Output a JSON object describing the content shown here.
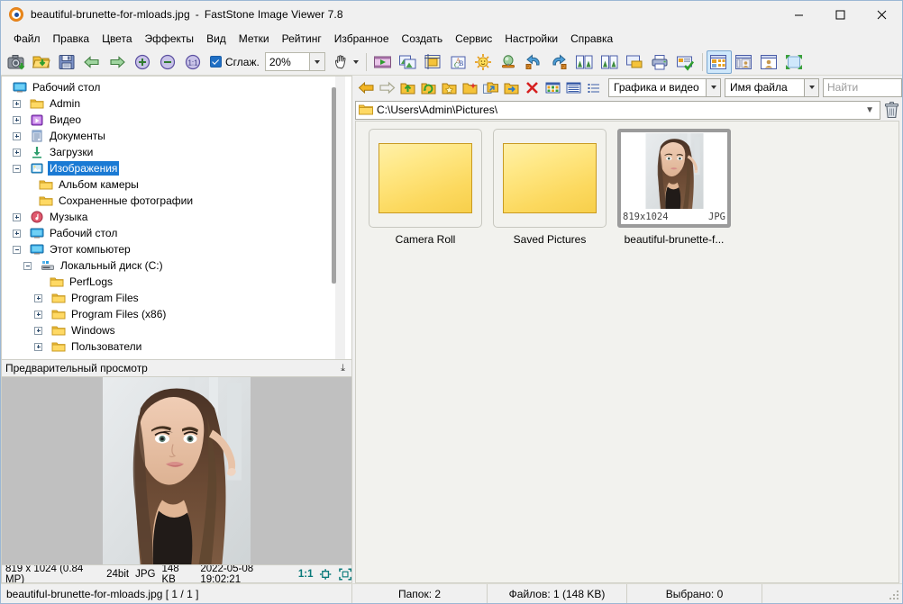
{
  "window": {
    "icon": "faststone-eye-icon",
    "file_name": "beautiful-brunette-for-mloads.jpg",
    "separator": "-",
    "app_title": "FastStone Image Viewer 7.8",
    "minimize_label": "—",
    "maximize_label": "□",
    "close_label": "✕"
  },
  "menu": {
    "items": [
      {
        "label": "Файл",
        "name": "menu-file"
      },
      {
        "label": "Правка",
        "name": "menu-edit"
      },
      {
        "label": "Цвета",
        "name": "menu-colors"
      },
      {
        "label": "Эффекты",
        "name": "menu-effects"
      },
      {
        "label": "Вид",
        "name": "menu-view"
      },
      {
        "label": "Метки",
        "name": "menu-tags"
      },
      {
        "label": "Рейтинг",
        "name": "menu-rating"
      },
      {
        "label": "Избранное",
        "name": "menu-favorites"
      },
      {
        "label": "Создать",
        "name": "menu-create"
      },
      {
        "label": "Сервис",
        "name": "menu-tools"
      },
      {
        "label": "Настройки",
        "name": "menu-settings"
      },
      {
        "label": "Справка",
        "name": "menu-help"
      }
    ]
  },
  "toolbar": {
    "smoothing_label": "Сглаж.",
    "smoothing_checked": true,
    "zoom_value": "20%",
    "icons": [
      "acquire-camera-icon",
      "open-folder-icon",
      "save-as-icon",
      "previous-image-icon",
      "next-image-icon",
      "zoom-in-icon",
      "zoom-out-icon",
      "actual-size-icon"
    ],
    "icons2": [
      "slideshow-icon",
      "compare-images-icon",
      "crop-icon",
      "adjust-colors-icon",
      "adjust-lighting-icon",
      "red-eye-icon",
      "rotate-left-icon",
      "rotate-right-icon",
      "resize-icon",
      "resize-canvas-icon",
      "screen-capture-icon",
      "print-icon",
      "email-icon"
    ],
    "view_modes": [
      "thumbnail-view-icon",
      "filmstrip-view-icon",
      "preview-view-icon",
      "fullscreen-icon"
    ],
    "active_view_mode_index": 0,
    "hand_tool": "hand-tool-icon",
    "accent_selected": "#cfe8fb"
  },
  "tree": {
    "scroll_position": "top",
    "nodes": [
      {
        "label": "Рабочий стол",
        "icon": "desktop-icon",
        "indent": 0,
        "expander": "none",
        "selected": false
      },
      {
        "label": "Admin",
        "icon": "folder-icon",
        "indent": 1,
        "expander": "plus",
        "selected": false
      },
      {
        "label": "Видео",
        "icon": "videos-icon",
        "indent": 1,
        "expander": "plus",
        "selected": false
      },
      {
        "label": "Документы",
        "icon": "documents-icon",
        "indent": 1,
        "expander": "plus",
        "selected": false
      },
      {
        "label": "Загрузки",
        "icon": "downloads-icon",
        "indent": 1,
        "expander": "plus",
        "selected": false
      },
      {
        "label": "Изображения",
        "icon": "pictures-icon",
        "indent": 1,
        "expander": "minus",
        "selected": true
      },
      {
        "label": "Альбом камеры",
        "icon": "folder-icon",
        "indent": 2,
        "expander": "none",
        "selected": false
      },
      {
        "label": "Сохраненные фотографии",
        "icon": "folder-icon",
        "indent": 2,
        "expander": "none",
        "selected": false
      },
      {
        "label": "Музыка",
        "icon": "music-icon",
        "indent": 1,
        "expander": "plus",
        "selected": false
      },
      {
        "label": "Рабочий стол",
        "icon": "desktop-icon",
        "indent": 1,
        "expander": "plus",
        "selected": false
      },
      {
        "label": "Этот компьютер",
        "icon": "computer-icon",
        "indent": 1,
        "expander": "minus",
        "selected": false
      },
      {
        "label": "Локальный диск (C:)",
        "icon": "harddisk-icon",
        "indent": 2,
        "expander": "minus",
        "selected": false
      },
      {
        "label": "PerfLogs",
        "icon": "folder-icon",
        "indent": 3,
        "expander": "none",
        "selected": false
      },
      {
        "label": "Program Files",
        "icon": "folder-icon",
        "indent": 3,
        "expander": "plus",
        "selected": false
      },
      {
        "label": "Program Files (x86)",
        "icon": "folder-icon",
        "indent": 3,
        "expander": "plus",
        "selected": false
      },
      {
        "label": "Windows",
        "icon": "folder-icon",
        "indent": 3,
        "expander": "plus",
        "selected": false
      },
      {
        "label": "Пользователи",
        "icon": "folder-icon",
        "indent": 3,
        "expander": "plus",
        "selected": false
      }
    ]
  },
  "preview": {
    "header": "Предварительный просмотр",
    "collapse_icon": "chevron-double-down-icon",
    "image": "portrait-photo",
    "status": {
      "dimensions": "819 x 1024 (0.84 MP)",
      "depth": "24bit",
      "format": "JPG",
      "size": "148 KB",
      "datetime": "2022-05-08 19:02:21",
      "ratio": "1:1",
      "fit_icon": "fit-window-icon",
      "full_icon": "actual-pixels-icon"
    }
  },
  "browser": {
    "nav_icons": [
      "back-arrow-icon",
      "forward-arrow-icon",
      "up-folder-icon",
      "refresh-folder-icon",
      "favorites-folder-icon",
      "new-folder-icon",
      "copy-to-folder-icon",
      "move-to-folder-icon",
      "delete-icon",
      "thumbnails-mode-icon",
      "list-mode-icon",
      "details-mode-icon"
    ],
    "filter_value": "Графика и видео",
    "sort_value": "Имя файла",
    "find_placeholder": "Найти",
    "path": "C:\\Users\\Admin\\Pictures\\",
    "path_icon": "folder-icon",
    "path_chevron": "chevron-down-icon",
    "trash_icon": "recycle-bin-icon"
  },
  "thumbnails": [
    {
      "label": "Camera Roll",
      "type": "folder",
      "selected": false
    },
    {
      "label": "Saved Pictures",
      "type": "folder",
      "selected": false
    },
    {
      "label": "beautiful-brunette-f...",
      "type": "image",
      "selected": true,
      "dimensions": "819x1024",
      "format": "JPG"
    }
  ],
  "statusbar": {
    "current_file": "beautiful-brunette-for-mloads.jpg [ 1 / 1 ]",
    "folders": "Папок: 2",
    "files": "Файлов: 1 (148 KB)",
    "selected": "Выбрано: 0"
  }
}
